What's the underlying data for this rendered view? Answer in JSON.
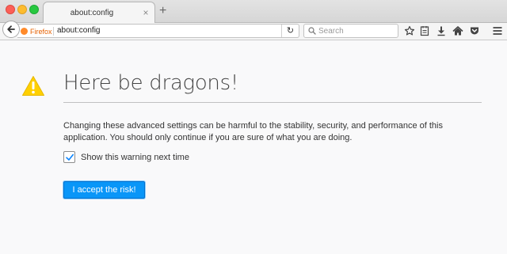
{
  "window": {
    "tab_title": "about:config",
    "tab_close": "×",
    "new_tab": "+"
  },
  "navbar": {
    "identity_label": "Firefox",
    "url": "about:config",
    "reload": "↻",
    "search_placeholder": "Search",
    "toolbar_icons": [
      "bookmark-star-icon",
      "reading-list-icon",
      "downloads-icon",
      "home-icon",
      "pocket-icon",
      "menu-icon"
    ]
  },
  "page": {
    "title": "Here be dragons!",
    "message": "Changing these advanced settings can be harmful to the stability, security, and performance of this application. You should only continue if you are sure of what you are doing.",
    "checkbox_label": "Show this warning next time",
    "checkbox_checked": true,
    "accept_button": "I accept the risk!"
  },
  "colors": {
    "accent": "#0996f8",
    "warning": "#ffd000",
    "brand": "#e66000"
  }
}
